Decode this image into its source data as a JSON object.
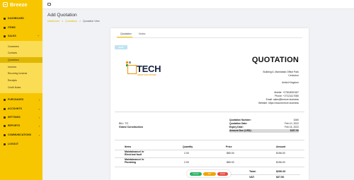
{
  "sidebar": {
    "brand": "Breeze",
    "items": [
      {
        "label": "DASHBOARD"
      },
      {
        "label": "ITEMS"
      },
      {
        "label": "SALES"
      },
      {
        "label": "PURCHASES"
      },
      {
        "label": "ACCOUNTS"
      },
      {
        "label": "SETTINGS"
      },
      {
        "label": "REPORTS"
      },
      {
        "label": "COMMUNICATIONS"
      },
      {
        "label": "LOGOUT"
      }
    ],
    "sales_sub": [
      {
        "label": "Customers"
      },
      {
        "label": "Contacts"
      },
      {
        "label": "Quotations"
      },
      {
        "label": "Invoices"
      },
      {
        "label": "Recurring Invoices"
      },
      {
        "label": "Receipts"
      },
      {
        "label": "Credit Notes"
      }
    ]
  },
  "header": {
    "title": "Add Quotation",
    "crumbs": [
      "Dashboard",
      "Quotations",
      "Quotation View"
    ]
  },
  "card": {
    "tabs": [
      "Quotation",
      "Notes"
    ],
    "status_badge": "Draft"
  },
  "logo": {
    "word": "TECH",
    "sub": "GOOD SOLUTIONS",
    "colors": {
      "orange": "#f39200",
      "navy": "#15233c",
      "green": "#1aa34a",
      "gray": "#9a9a9a"
    }
  },
  "quotation": {
    "title": "QUOTATION",
    "address": [
      "Building 6, Manhattan Office Park",
      "Centurion",
      "United Kingdom"
    ],
    "contact": [
      "Mobile: +27818000187",
      "Phone: +27121117080",
      "Email: sales@breeze.business",
      "Website: https://www.breeze.business"
    ],
    "bill_to_label": "BILL TO",
    "bill_to_name": "Grand Construction",
    "meta": [
      {
        "k": "Quotation Number:",
        "v": "1060"
      },
      {
        "k": "Quotation Date:",
        "v": "Feb 10, 2022"
      },
      {
        "k": "Expiry Date:",
        "v": "Feb 16, 2022"
      },
      {
        "k": "Amount Due (USD):",
        "v": "$287.50"
      }
    ],
    "columns": [
      "Items",
      "Quantity",
      "Price",
      "Amount"
    ],
    "rows": [
      {
        "item": "Maintainance/ hr Electrical fault",
        "qty": "2.00",
        "price": "$80.00",
        "amount": "$156.00"
      },
      {
        "item": "Maintainance/ hr Plumbing",
        "qty": "2.00",
        "price": "$80.00",
        "amount": "$156.00"
      }
    ],
    "total_label": "Total:",
    "total_value": "$250.00",
    "vat_label": "VAT:",
    "vat_value": "$37.50"
  },
  "actions": [
    {
      "label": "Convert",
      "color": "#28b463"
    },
    {
      "label": "Edit",
      "color": "#f0a500"
    },
    {
      "label": "Delete",
      "color": "#e74c3c"
    }
  ],
  "colors": {
    "sidebar": "#f7c600",
    "accent": "#e0b400"
  }
}
